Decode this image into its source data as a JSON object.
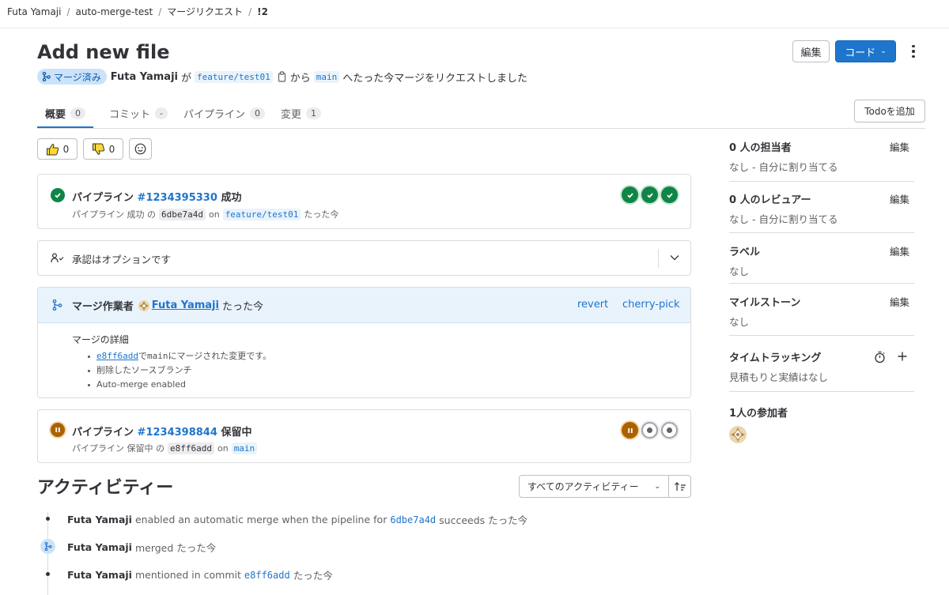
{
  "breadcrumb": {
    "items": [
      "Futa Yamaji",
      "auto-merge-test",
      "マージリクエスト",
      "!2"
    ],
    "separator": "/"
  },
  "header": {
    "title": "Add new file",
    "edit_label": "編集",
    "code_label": "コード",
    "status_badge": "マージ済み",
    "author": "Futa Yamaji",
    "text_ga": "が",
    "source_branch": "feature/test01",
    "text_kara": "から",
    "target_branch": "main",
    "text_tail": "へたった今マージをリクエストしました"
  },
  "tabs": [
    {
      "label": "概要",
      "count": "0"
    },
    {
      "label": "コミット",
      "count": "-"
    },
    {
      "label": "パイプライン",
      "count": "0"
    },
    {
      "label": "変更",
      "count": "1"
    }
  ],
  "todo_label": "Todoを追加",
  "reactions": {
    "thumbs_up": "0",
    "thumbs_down": "0"
  },
  "pipeline1": {
    "prefix": "パイプライン",
    "id": "#1234395330",
    "status": "成功",
    "sub_prefix": "パイプライン 成功 の",
    "commit": "6dbe7a4d",
    "on": "on",
    "branch": "feature/test01",
    "time": "たった今",
    "stages": [
      "success",
      "success",
      "success"
    ]
  },
  "approval": {
    "text": "承認はオプションです"
  },
  "merge": {
    "label": "マージ作業者",
    "user": "Futa Yamaji",
    "time": "たった今",
    "revert": "revert",
    "cherry_pick": "cherry-pick",
    "details_title": "マージの詳細",
    "detail_commit": "e8ff6add",
    "detail_commit_text_1": "で",
    "detail_commit_branch": "main",
    "detail_commit_text_2": "にマージされた変更です。",
    "detail_2": "削除したソースブランチ",
    "detail_3": "Auto-merge enabled"
  },
  "pipeline2": {
    "prefix": "パイプライン",
    "id": "#1234398844",
    "status": "保留中",
    "sub_prefix": "パイプライン 保留中 の",
    "commit": "e8ff6add",
    "on": "on",
    "branch": "main",
    "stages": [
      "pending",
      "created",
      "created"
    ]
  },
  "activity": {
    "title": "アクティビティー",
    "filter": "すべてのアクティビティー",
    "items": [
      {
        "who": "Futa Yamaji",
        "text": "enabled an automatic merge when the pipeline for",
        "ref": "6dbe7a4d",
        "tail": "succeeds たった今"
      },
      {
        "who": "Futa Yamaji",
        "text": "merged たった今"
      },
      {
        "who": "Futa Yamaji",
        "text": "mentioned in commit",
        "ref": "e8ff6add",
        "tail": "たった今"
      }
    ]
  },
  "sidebar": {
    "edit_label": "編集",
    "assignees_title": "0 人の担当者",
    "assignees_value": "なし - 自分に割り当てる",
    "reviewers_title": "0 人のレビュアー",
    "reviewers_value": "なし - 自分に割り当てる",
    "labels_title": "ラベル",
    "labels_value": "なし",
    "milestone_title": "マイルストーン",
    "milestone_value": "なし",
    "time_title": "タイムトラッキング",
    "time_value": "見積もりと実績はなし",
    "participants_title": "1人の参加者"
  },
  "colors": {
    "accent": "#1f75cb",
    "success": "#108548",
    "pending": "#ab6100",
    "merged_bg": "#cbe2f9"
  }
}
